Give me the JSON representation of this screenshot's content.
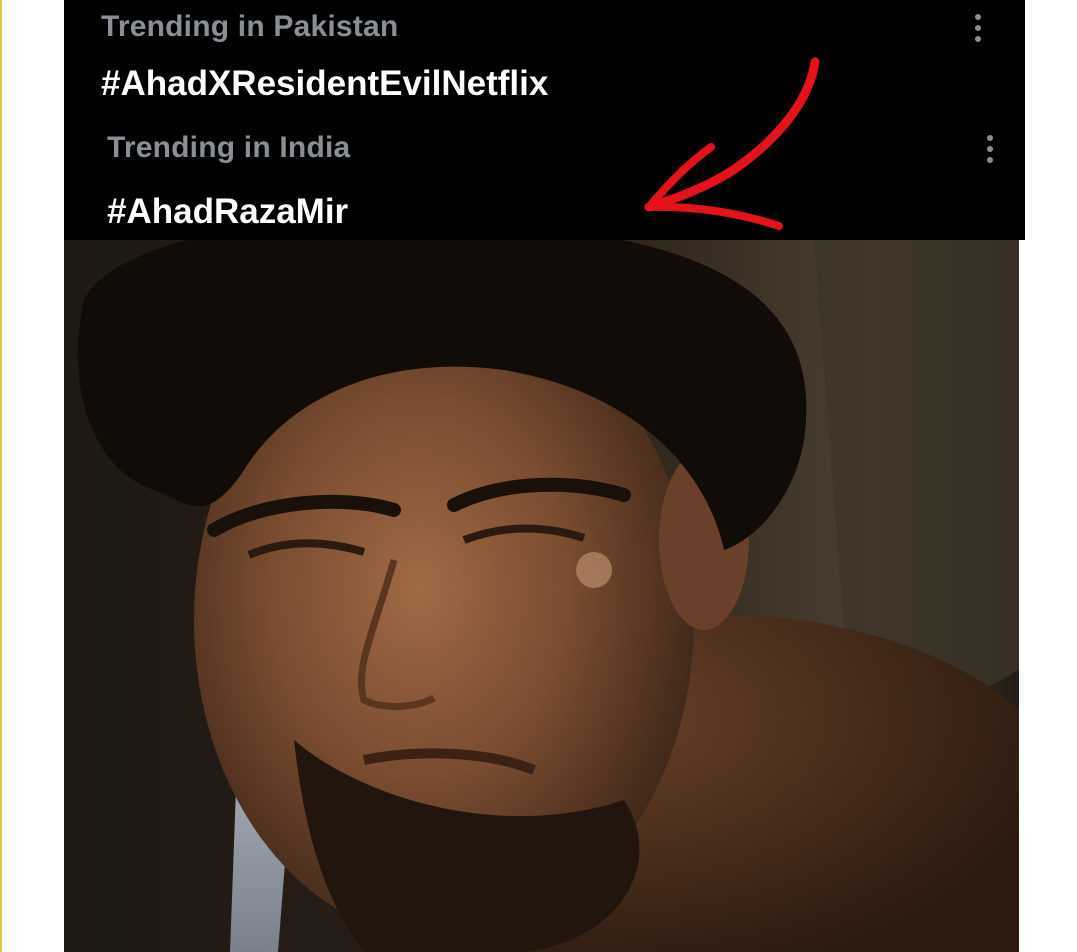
{
  "trends": [
    {
      "category": "Trending in Pakistan",
      "hashtag": "#AhadXResidentEvilNetflix",
      "more_icon": "more-vertical-icon"
    },
    {
      "category": "Trending in India",
      "hashtag": "#AhadRazaMir",
      "more_icon": "more-vertical-icon"
    }
  ],
  "annotation": {
    "type": "hand-drawn arrow",
    "color": "#e3121b",
    "points_to": "#AhadRazaMir"
  },
  "colors": {
    "panel_background": "#000000",
    "category_text": "#8a8f96",
    "hashtag_text": "#ffffff",
    "page_background": "#ffffff"
  }
}
